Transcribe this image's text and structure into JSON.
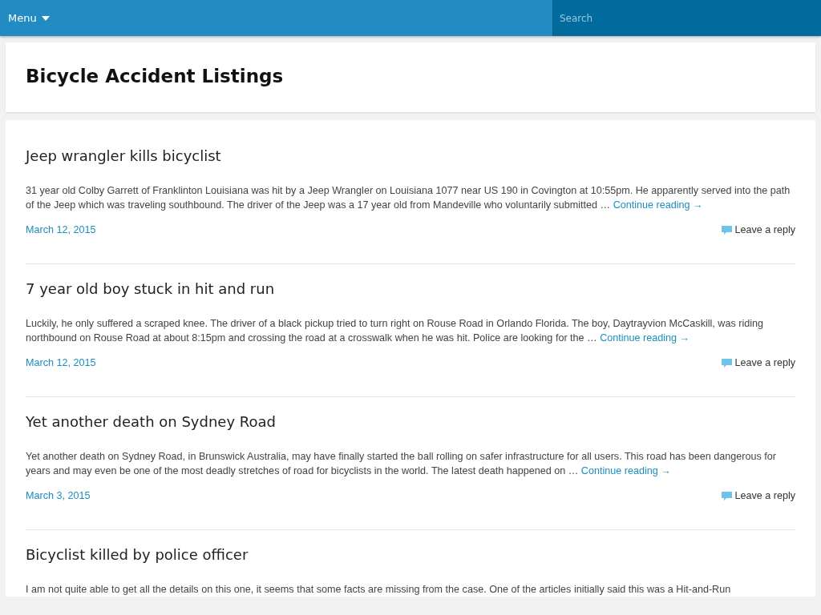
{
  "topbar": {
    "menu_label": "Menu",
    "search": {
      "placeholder": "Search"
    }
  },
  "page_title": "Bicycle Accident Listings",
  "posts": [
    {
      "title": "Jeep wrangler kills bicyclist",
      "excerpt": "31 year old Colby Garrett of Franklinton Louisiana was hit by a Jeep Wrangler on Louisiana 1077 near US 190 in Covington at 10:55pm. He apparently served into the path of the Jeep which was traveling southbound. The driver of the Jeep was a 17 year old from Mandeville who voluntarily submitted …",
      "more_link": "Continue reading →",
      "date": "March 12, 2015",
      "reply_link": "Leave a reply"
    },
    {
      "title": "7 year old boy stuck in hit and run",
      "excerpt": "Luckily, he only suffered a scraped knee. The driver of a black pickup tried to turn right on Rouse Road in Orlando Florida. The boy, Daytrayvion McCaskill, was riding northbound on Rouse Road at about 8:15pm and crossing the road at a crosswalk when he was hit. Police are looking for the …",
      "more_link": "Continue reading →",
      "date": "March 12, 2015",
      "reply_link": "Leave a reply"
    },
    {
      "title": "Yet another death on Sydney Road",
      "excerpt": "Yet another death on Sydney Road, in Brunswick Australia, may have finally started the ball rolling on safer infrastructure for all users. This road has been dangerous for years and may even be one of the most deadly stretches of road for bicyclists in the world. The latest death happened on …",
      "more_link": "Continue reading →",
      "date": "March 3, 2015",
      "reply_link": "Leave a reply"
    },
    {
      "title": "Bicyclist killed by police officer",
      "excerpt": "I am not quite able to get all the details on this one, it seems that some facts are missing from the case. One of the articles initially said this was a Hit-and-Run"
    }
  ]
}
